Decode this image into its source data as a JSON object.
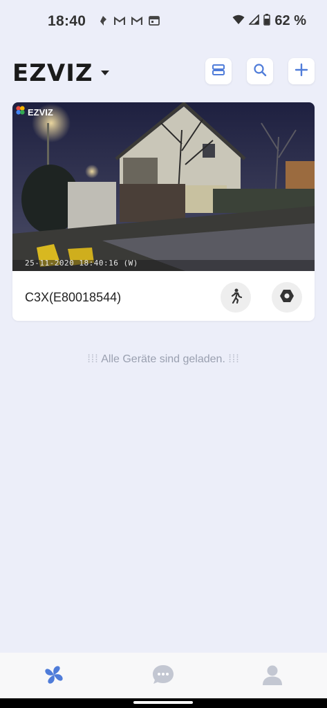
{
  "status_bar": {
    "time": "18:40",
    "left_icons": [
      "notification-icon",
      "gmail-icon",
      "gmail-icon",
      "calendar-icon"
    ],
    "right_icons": [
      "wifi-icon",
      "signal-icon",
      "battery-icon"
    ],
    "battery": "62 %"
  },
  "header": {
    "logo": "EZVIZ",
    "buttons": [
      "list-view-icon",
      "search-icon",
      "add-icon"
    ]
  },
  "device_card": {
    "preview_logo": "EZVIZ",
    "timestamp_overlay": "25-11-2020 18:40:16 (W)",
    "device_name": "C3X(E80018544)",
    "actions": [
      "motion-detection-icon",
      "settings-icon"
    ]
  },
  "list_status": {
    "message": "Alle Geräte sind geladen."
  },
  "bottom_nav": {
    "items": [
      "home-icon",
      "messages-icon",
      "profile-icon"
    ],
    "active_color": "#4f7cd9"
  },
  "colors": {
    "background": "#eceef9",
    "accent": "#4f7cd9"
  }
}
